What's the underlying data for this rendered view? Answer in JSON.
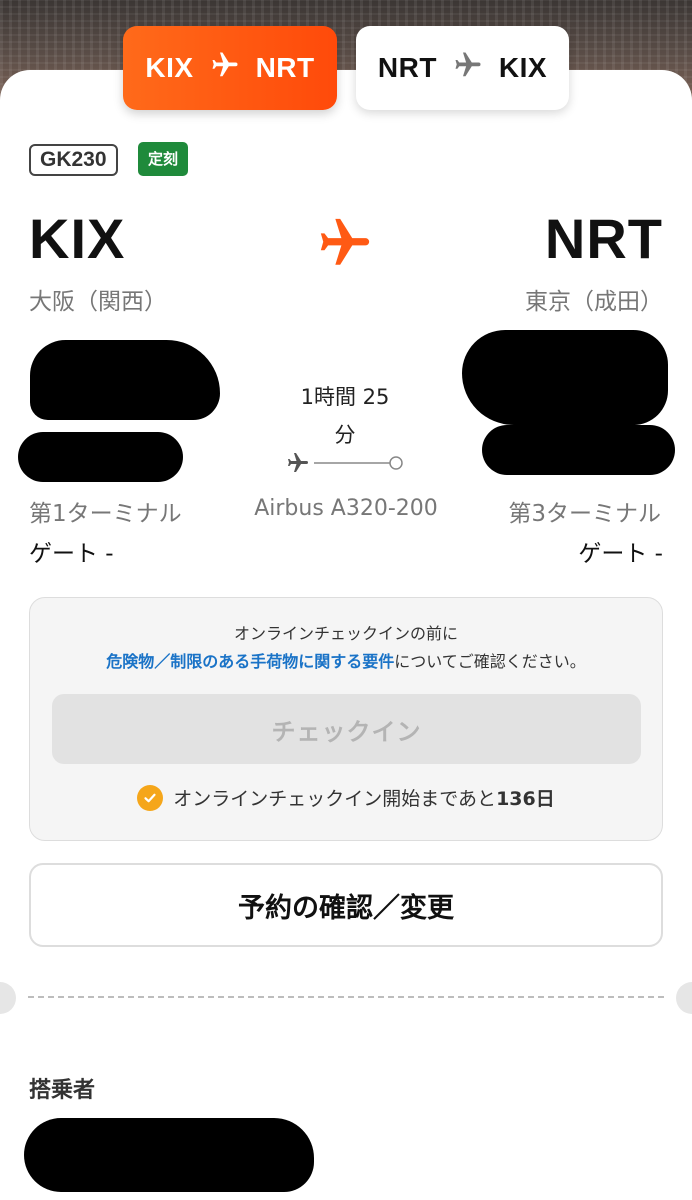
{
  "tabs": [
    {
      "from": "KIX",
      "to": "NRT",
      "active": true
    },
    {
      "from": "NRT",
      "to": "KIX",
      "active": false
    }
  ],
  "flight": {
    "number": "GK230",
    "status": "定刻",
    "status_color": "#1f8a3b",
    "accent_color": "#ff5a14"
  },
  "origin": {
    "code": "KIX",
    "city": "大阪（関西）",
    "terminal": "第1ターミナル",
    "gate": "ゲート -"
  },
  "destination": {
    "code": "NRT",
    "city": "東京（成田）",
    "terminal": "第3ターミナル",
    "gate": "ゲート -"
  },
  "duration": {
    "line1": "1時間 25",
    "line2": "分"
  },
  "aircraft": "Airbus A320-200",
  "checkin": {
    "notice_prefix": "オンラインチェックインの前に",
    "notice_link": "危険物／制限のある手荷物に関する要件",
    "notice_suffix": "についてご確認ください。",
    "button_label": "チェックイン",
    "countdown_prefix": "オンラインチェックイン開始まであと",
    "countdown_value": "136日"
  },
  "reservation_button": "予約の確認／変更",
  "passengers_label": "搭乗者",
  "icons": [
    "plane-icon",
    "check-circle-icon",
    "route-dot-icon"
  ]
}
